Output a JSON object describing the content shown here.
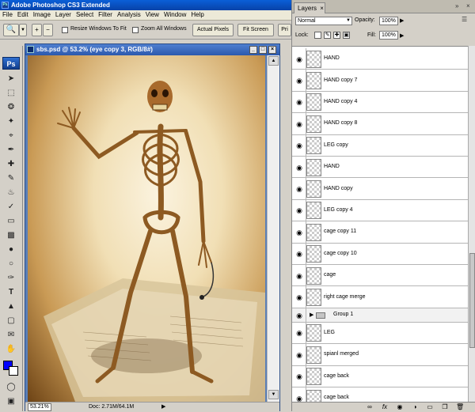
{
  "app": {
    "title": "Adobe Photoshop CS3 Extended",
    "logo": "Ps"
  },
  "menu": [
    "File",
    "Edit",
    "Image",
    "Layer",
    "Select",
    "Filter",
    "Analysis",
    "View",
    "Window",
    "Help"
  ],
  "options": {
    "resize_label": "Resize Windows To Fit",
    "zoom_all_label": "Zoom All Windows",
    "actual_pixels": "Actual Pixels",
    "fit_screen": "Fit Screen",
    "print_size": "Pri"
  },
  "document": {
    "title": "sbs.psd @ 53.2% (eye copy 3, RGB/8#)",
    "zoom": "53.21%",
    "doc_info": "Doc: 2.71M/64.1M"
  },
  "colors": {
    "foreground": "#0000ff",
    "background": "#ffffff"
  },
  "layers_panel": {
    "tab": "Layers",
    "close": "×",
    "blend_mode": "Normal",
    "opacity_label": "Opacity:",
    "opacity": "100%",
    "lock_label": "Lock:",
    "fill_label": "Fill:",
    "fill": "100%",
    "layers": [
      {
        "name": "HAND",
        "type": "layer"
      },
      {
        "name": "HAND copy 7",
        "type": "layer"
      },
      {
        "name": "HAND copy 4",
        "type": "layer"
      },
      {
        "name": "HAND copy 8",
        "type": "layer"
      },
      {
        "name": "LEG copy",
        "type": "layer"
      },
      {
        "name": "HAND",
        "type": "layer"
      },
      {
        "name": "HAND copy",
        "type": "layer"
      },
      {
        "name": "LEG copy 4",
        "type": "layer"
      },
      {
        "name": "cage copy 11",
        "type": "layer"
      },
      {
        "name": "cage copy 10",
        "type": "layer"
      },
      {
        "name": "cage",
        "type": "layer"
      },
      {
        "name": "right  cage merge",
        "type": "layer"
      },
      {
        "name": "Group 1",
        "type": "group"
      },
      {
        "name": "LEG",
        "type": "layer"
      },
      {
        "name": "spianl merged",
        "type": "layer"
      },
      {
        "name": "cage back",
        "type": "layer"
      },
      {
        "name": "cage back",
        "type": "layer"
      }
    ]
  }
}
